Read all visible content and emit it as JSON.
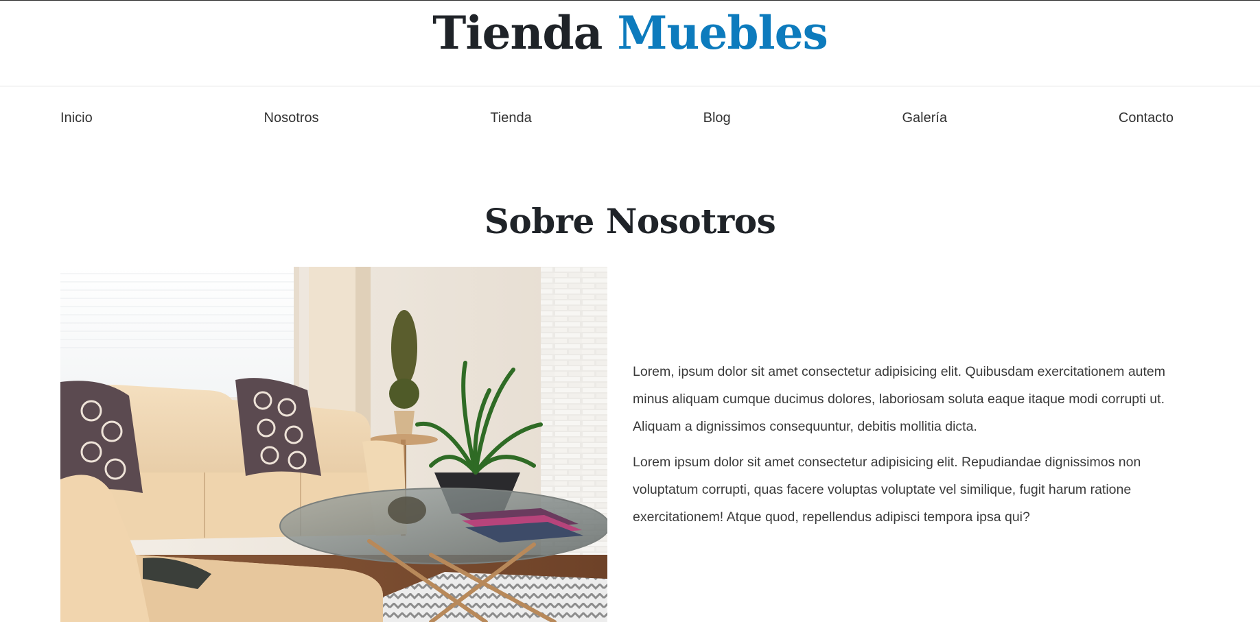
{
  "header": {
    "logo_primary": "Tienda",
    "logo_accent": "Muebles",
    "accent_color": "#0d7bbd"
  },
  "nav": {
    "items": [
      {
        "label": "Inicio"
      },
      {
        "label": "Nosotros"
      },
      {
        "label": "Tienda"
      },
      {
        "label": "Blog"
      },
      {
        "label": "Galería"
      },
      {
        "label": "Contacto"
      }
    ]
  },
  "about": {
    "title": "Sobre Nosotros",
    "paragraphs": [
      "Lorem, ipsum dolor sit amet consectetur adipisicing elit. Quibusdam exercitationem autem minus aliquam cumque ducimus dolores, laboriosam soluta eaque itaque modi corrupti ut. Aliquam a dignissimos consequuntur, debitis mollitia dicta.",
      "Lorem ipsum dolor sit amet consectetur adipisicing elit. Repudiandae dignissimos non voluptatum corrupti, quas facere voluptas voluptate vel similique, fugit harum ratione exercitationem! Atque quod, repellendus adipisci tempora ipsa qui?"
    ]
  }
}
